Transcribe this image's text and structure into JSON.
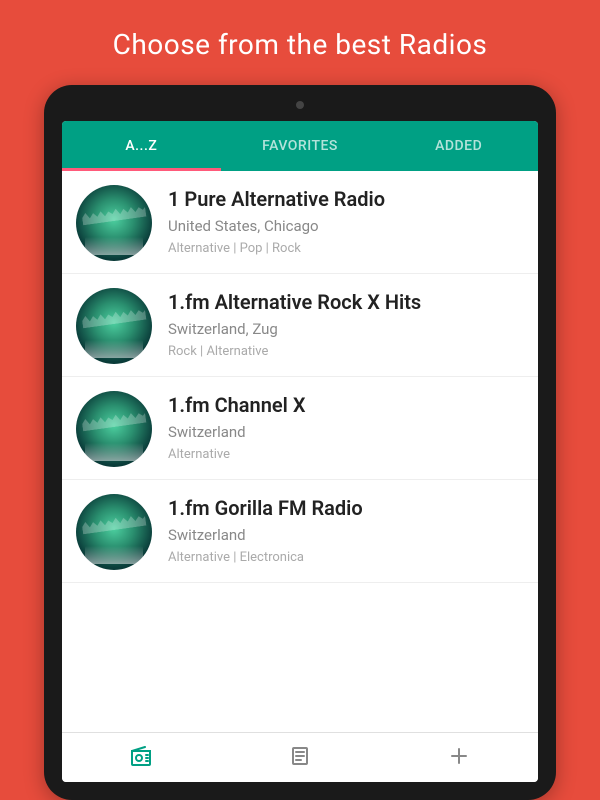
{
  "headline": "Choose from the best Radios",
  "tabs": [
    {
      "label": "A...Z",
      "active": true
    },
    {
      "label": "FAVORITES",
      "active": false
    },
    {
      "label": "ADDED",
      "active": false
    }
  ],
  "stations": [
    {
      "name": "1 Pure Alternative Radio",
      "location": "United States, Chicago",
      "genres": "Alternative | Pop | Rock"
    },
    {
      "name": "1.fm Alternative Rock X Hits",
      "location": "Switzerland, Zug",
      "genres": "Rock | Alternative"
    },
    {
      "name": "1.fm Channel X",
      "location": "Switzerland",
      "genres": "Alternative"
    },
    {
      "name": "1.fm Gorilla FM Radio",
      "location": "Switzerland",
      "genres": "Alternative | Electronica"
    }
  ],
  "bottomnav": {
    "radio_active": true
  },
  "colors": {
    "bg": "#e74c3c",
    "accent": "#00a084",
    "indicator": "#ff5a7a"
  }
}
